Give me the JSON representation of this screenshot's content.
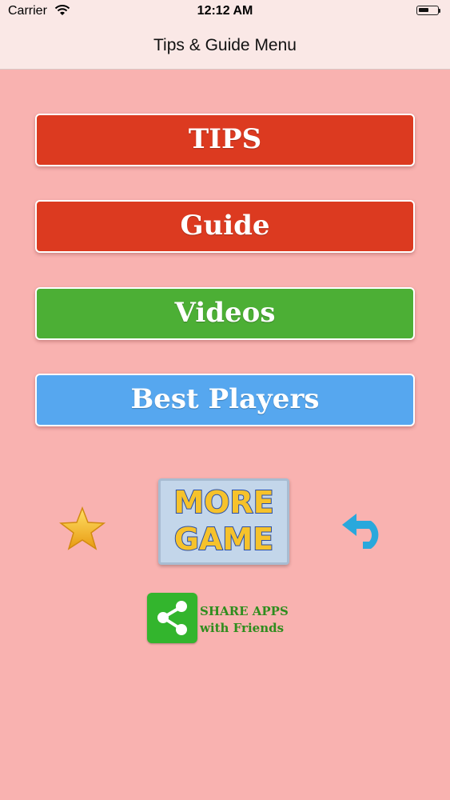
{
  "status_bar": {
    "carrier": "Carrier",
    "time": "12:12 AM",
    "battery_level": 0.55
  },
  "nav": {
    "title": "Tips & Guide Menu"
  },
  "menu": {
    "tips": "TIPS",
    "guide": "Guide",
    "videos": "Videos",
    "best_players": "Best Players"
  },
  "colors": {
    "background": "#f9b2b0",
    "red_button": "#dc3a20",
    "green_button": "#4caf35",
    "blue_button": "#56a7ef"
  },
  "more_game": {
    "line1": "MORE",
    "line2": "GAME"
  },
  "share": {
    "line1": "SHARE APPS",
    "line2": "with Friends"
  },
  "icons": [
    "wifi-icon",
    "battery-icon",
    "star-icon",
    "back-arrow-icon",
    "share-icon"
  ]
}
